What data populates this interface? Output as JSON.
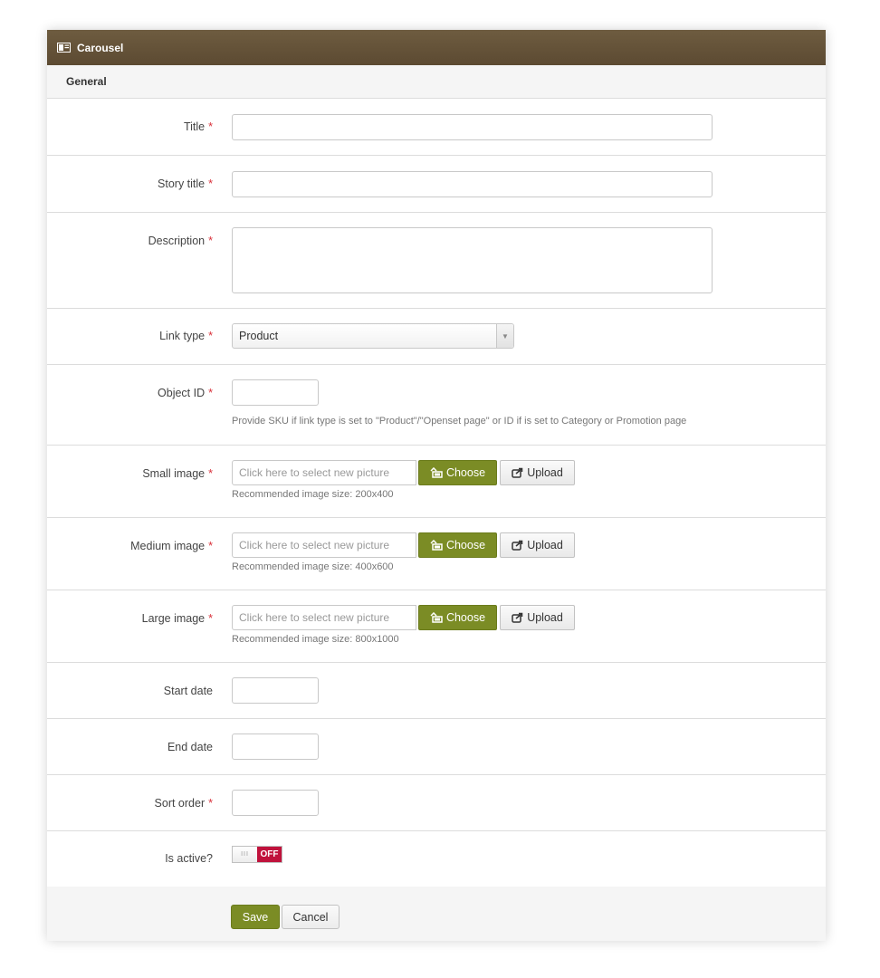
{
  "panel": {
    "title": "Carousel",
    "title_icon": "image-icon",
    "section": "General"
  },
  "fields": {
    "title": {
      "label": "Title",
      "required": "*",
      "value": ""
    },
    "story_title": {
      "label": "Story title",
      "required": "*",
      "value": ""
    },
    "description": {
      "label": "Description",
      "required": "*",
      "value": ""
    },
    "link_type": {
      "label": "Link type",
      "required": "*",
      "selected": "Product"
    },
    "object_id": {
      "label": "Object ID",
      "required": "*",
      "value": "",
      "help": "Provide SKU if link type is set to \"Product\"/\"Openset page\" or ID if is set to Category or Promotion page"
    },
    "small_image": {
      "label": "Small image",
      "required": "*",
      "placeholder": "Click here to select new picture",
      "help": "Recommended image size: 200x400"
    },
    "medium_image": {
      "label": "Medium image",
      "required": "*",
      "placeholder": "Click here to select new picture",
      "help": "Recommended image size: 400x600"
    },
    "large_image": {
      "label": "Large image",
      "required": "*",
      "placeholder": "Click here to select new picture",
      "help": "Recommended image size: 800x1000"
    },
    "start_date": {
      "label": "Start date",
      "value": ""
    },
    "end_date": {
      "label": "End date",
      "value": ""
    },
    "sort_order": {
      "label": "Sort order",
      "required": "*",
      "value": ""
    },
    "is_active": {
      "label": "Is active?",
      "knob": "III",
      "state": "OFF"
    }
  },
  "buttons": {
    "choose": "Choose",
    "upload": "Upload",
    "save": "Save",
    "cancel": "Cancel"
  },
  "colors": {
    "header": "#5f4d35",
    "accent_green": "#7b8c25",
    "required_red": "#d9313b",
    "toggle_off": "#c0123c"
  }
}
